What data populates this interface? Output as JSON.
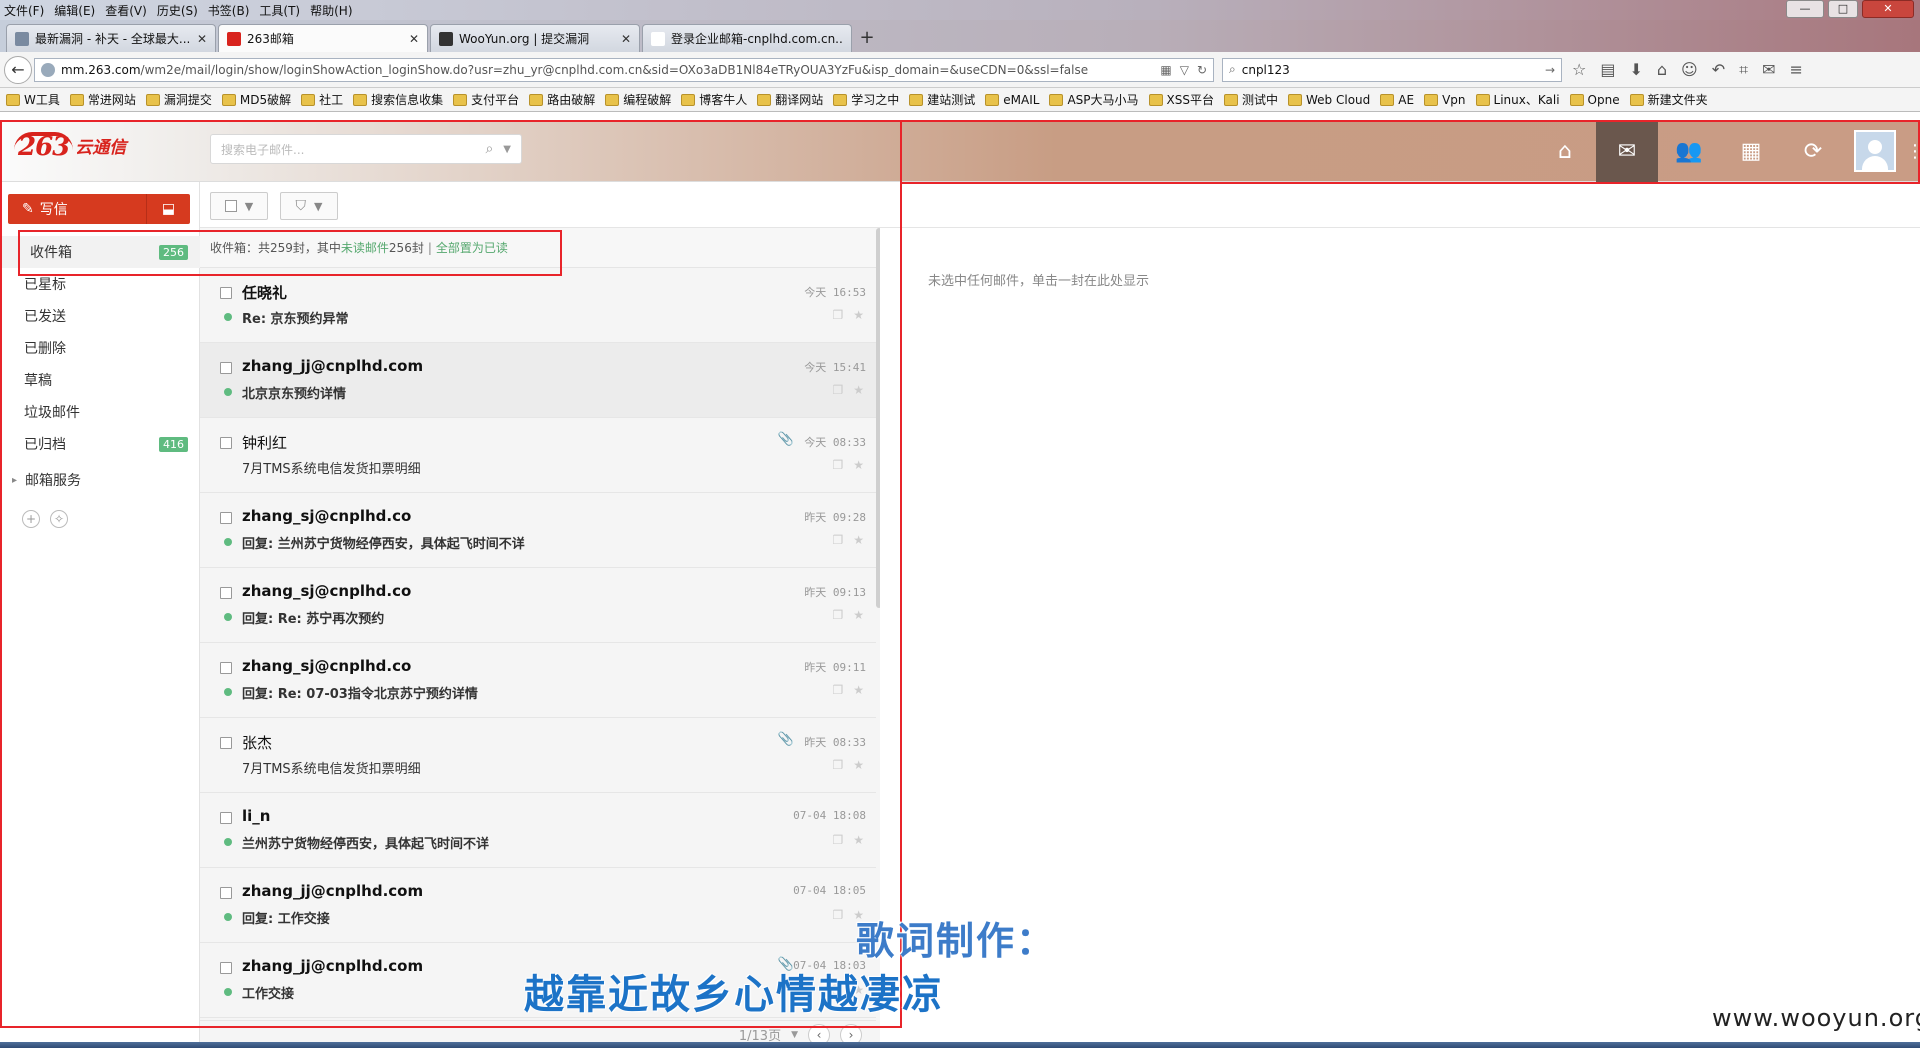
{
  "browser": {
    "menu": [
      "文件(F)",
      "编辑(E)",
      "查看(V)",
      "历史(S)",
      "书签(B)",
      "工具(T)",
      "帮助(H)"
    ],
    "tabs": [
      {
        "label": "最新漏洞 - 补天 - 全球最大...",
        "icon_color": "#7a8aa0"
      },
      {
        "label": "263邮箱",
        "icon_color": "#d8231d"
      },
      {
        "label": "WooYun.org | 提交漏洞",
        "icon_color": "#333333"
      },
      {
        "label": "登录企业邮箱-cnplhd.com.cn...",
        "icon_color": "#ffffff"
      }
    ],
    "new_tab_symbol": "+",
    "url_host": "mm.263.com",
    "url_rest": "/wm2e/mail/login/show/loginShowAction_loginShow.do?usr=zhu_yr@cnplhd.com.cn&sid=OXo3aDB1Nl84eTRyOUA3YzFu&isp_domain=&useCDN=0&ssl=false",
    "search_value": "cnpl123",
    "bookmarks": [
      "W工具",
      "常进网站",
      "漏洞提交",
      "MD5破解",
      "社工",
      "搜索信息收集",
      "支付平台",
      "路由破解",
      "编程破解",
      "博客牛人",
      "翻译网站",
      "学习之中",
      "建站测试",
      "eMAIL",
      "ASP大马小马",
      "XSS平台",
      "测试中",
      "Web Cloud",
      "AE",
      "Vpn",
      "Linux、Kali",
      "Opne",
      "新建文件夹"
    ]
  },
  "app": {
    "logo_num": "263",
    "logo_text": "云通信",
    "search_placeholder": "搜索电子邮件...",
    "nav_icons": [
      "home-icon",
      "mail-icon",
      "contacts-icon",
      "calendar-icon",
      "sync-icon"
    ],
    "write_label": "写信",
    "folders": [
      {
        "label": "收件箱",
        "count": "256",
        "active": true
      },
      {
        "label": "已星标",
        "count": ""
      },
      {
        "label": "已发送",
        "count": ""
      },
      {
        "label": "已删除",
        "count": ""
      },
      {
        "label": "草稿",
        "count": ""
      },
      {
        "label": "垃圾邮件",
        "count": ""
      },
      {
        "label": "已归档",
        "count": "416"
      }
    ],
    "service_label": "邮箱服务",
    "summary": {
      "prefix": "收件箱：共259封，其中",
      "unread_link": "未读邮件",
      "unread_count": "256封",
      "sep": "|",
      "mark_all": "全部置为已读"
    },
    "mails": [
      {
        "from": "任晓礼",
        "subject": "Re: 京东预约异常",
        "time": "今天 16:53",
        "unread": true,
        "attach": false,
        "selected": false
      },
      {
        "from": "zhang_jj@cnplhd.com",
        "subject": "北京京东预约详情",
        "time": "今天 15:41",
        "unread": true,
        "attach": false,
        "selected": true
      },
      {
        "from": "钟利红",
        "subject": "7月TMS系统电信发货扣票明细",
        "time": "今天 08:33",
        "unread": false,
        "attach": true,
        "selected": false
      },
      {
        "from": "zhang_sj@cnplhd.co",
        "subject": "回复: 兰州苏宁货物经停西安，具体起飞时间不详",
        "time": "昨天 09:28",
        "unread": true,
        "attach": false,
        "selected": false
      },
      {
        "from": "zhang_sj@cnplhd.co",
        "subject": "回复: Re: 苏宁再次预约",
        "time": "昨天 09:13",
        "unread": true,
        "attach": false,
        "selected": false
      },
      {
        "from": "zhang_sj@cnplhd.co",
        "subject": "回复: Re: 07-03指令北京苏宁预约详情",
        "time": "昨天 09:11",
        "unread": true,
        "attach": false,
        "selected": false
      },
      {
        "from": "张杰",
        "subject": "7月TMS系统电信发货扣票明细",
        "time": "昨天 08:33",
        "unread": false,
        "attach": true,
        "selected": false
      },
      {
        "from": "li_n",
        "subject": "兰州苏宁货物经停西安，具体起飞时间不详",
        "time": "07-04 18:08",
        "unread": true,
        "attach": false,
        "selected": false
      },
      {
        "from": "zhang_jj@cnplhd.com",
        "subject": "回复: 工作交接",
        "time": "07-04 18:05",
        "unread": true,
        "attach": false,
        "selected": false
      },
      {
        "from": "zhang_jj@cnplhd.com",
        "subject": "工作交接",
        "time": "07-04 18:03",
        "unread": true,
        "attach": true,
        "selected": false
      }
    ],
    "pager": "1/13页",
    "reading_empty": "未选中任何邮件，单击一封在此处显示"
  },
  "overlay": {
    "line1": "歌词制作：",
    "line2": "越靠近故乡心情越凄凉",
    "watermark": "www.wooyun.org"
  }
}
